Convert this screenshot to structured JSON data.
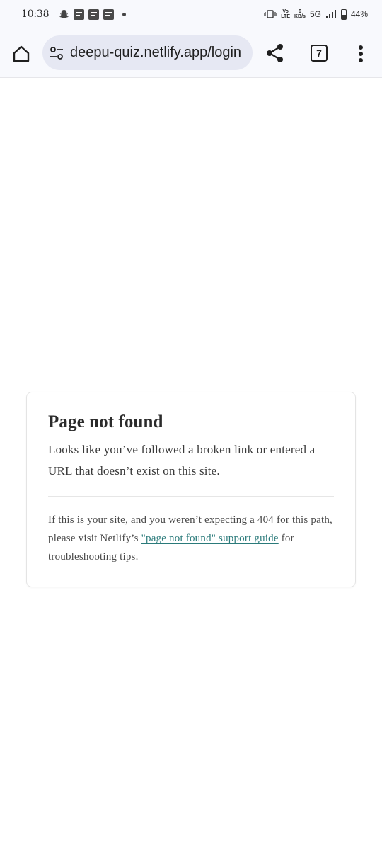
{
  "status_bar": {
    "time": "10:38",
    "icons": [
      "snapchat-icon",
      "notification-icon",
      "notification-icon",
      "notification-icon",
      "more-dot-icon"
    ],
    "vibrate": "vibrate-icon",
    "volte": "Vo̅ LTE",
    "speed_value": "6",
    "speed_unit": "KB/s",
    "network": "5G",
    "battery": "44%"
  },
  "browser": {
    "url": "deepu-quiz.netlify.app/login",
    "tab_count": "7"
  },
  "page": {
    "title": "Page not found",
    "lead": "Looks like you’ve followed a broken link or entered a URL that doesn’t exist on this site.",
    "note_before": "If this is your site, and you weren’t expecting a 404 for this path, please visit Netlify’s ",
    "note_link": "\"page not found\" support guide",
    "note_after": " for troubleshooting tips."
  },
  "colors": {
    "link": "#2a7a7a",
    "chrome_bg": "#f8f9fd",
    "url_pill": "#e6e8f3"
  }
}
